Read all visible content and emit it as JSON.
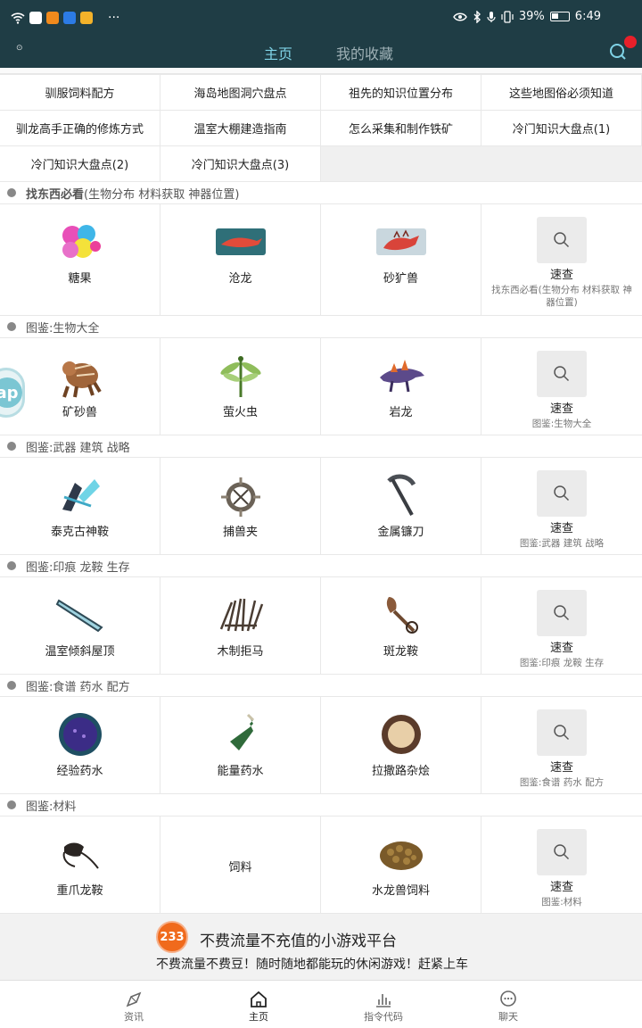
{
  "status": {
    "battery": "39%",
    "time": "6:49",
    "dots": "···"
  },
  "header": {
    "small_label": "⊙",
    "tab_active": "主页",
    "tab_inactive": "我的收藏"
  },
  "links": [
    "驯服饲料配方",
    "海岛地图洞穴盘点",
    "祖先的知识位置分布",
    "这些地图俗必须知道",
    "驯龙高手正确的修炼方式",
    "温室大棚建造指南",
    "怎么采集和制作铁矿",
    "冷门知识大盘点(1)",
    "冷门知识大盘点(2)",
    "冷门知识大盘点(3)"
  ],
  "sections": [
    {
      "bold": "找东西必看",
      "title": "(生物分布 材料获取 神器位置)",
      "items": [
        "糖果",
        "沧龙",
        "砂犷兽"
      ],
      "quick": "速查",
      "quick_sub": "找东西必看(生物分布 材料获取 神器位置)"
    },
    {
      "bold": "",
      "title": "图鉴:生物大全",
      "items": [
        "矿砂兽",
        "萤火虫",
        "岩龙"
      ],
      "quick": "速查",
      "quick_sub": "图鉴:生物大全"
    },
    {
      "bold": "",
      "title": "图鉴:武器 建筑 战略",
      "items": [
        "泰克古神鞍",
        "捕兽夹",
        "金属镰刀"
      ],
      "quick": "速查",
      "quick_sub": "图鉴:武器 建筑 战略"
    },
    {
      "bold": "",
      "title": "图鉴:印痕 龙鞍 生存",
      "items": [
        "温室倾斜屋顶",
        "木制拒马",
        "斑龙鞍"
      ],
      "quick": "速查",
      "quick_sub": "图鉴:印痕 龙鞍 生存"
    },
    {
      "bold": "",
      "title": "图鉴:食谱 药水 配方",
      "items": [
        "经验药水",
        "能量药水",
        "拉撒路杂烩"
      ],
      "quick": "速查",
      "quick_sub": "图鉴:食谱 药水 配方"
    },
    {
      "bold": "",
      "title": "图鉴:材料",
      "items": [
        "重爪龙鞍",
        "饲料",
        "水龙兽饲料"
      ],
      "quick": "速查",
      "quick_sub": "图鉴:材料"
    }
  ],
  "banner": {
    "logo": "233",
    "title": "不费流量不充值的小游戏平台",
    "subtitle": "不费流量不费豆！随时随地都能玩的休闲游戏！赶紧上车"
  },
  "side_badge": "ap",
  "nav": [
    {
      "label": "资讯",
      "icon": "compass-icon"
    },
    {
      "label": "主页",
      "icon": "home-icon"
    },
    {
      "label": "指令代码",
      "icon": "bar-chart-icon"
    },
    {
      "label": "聊天",
      "icon": "chat-icon"
    }
  ],
  "colors": {
    "header_bg": "#1f3d45",
    "active_tab": "#7fd3e6",
    "notify_dot": "#e8202a",
    "banner_logo": "#f06a1c"
  }
}
